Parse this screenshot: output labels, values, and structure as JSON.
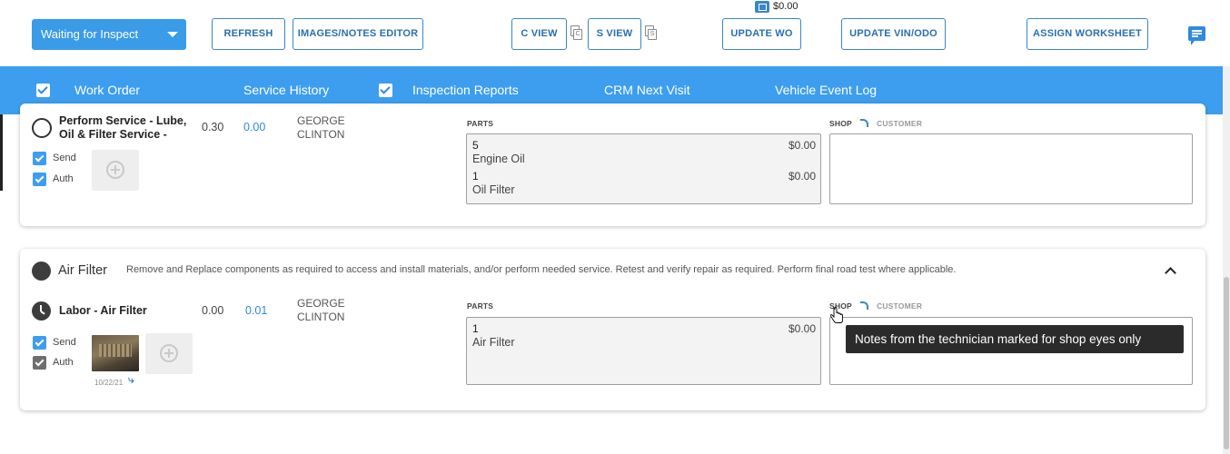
{
  "toolbar": {
    "status_value": "Waiting for Inspect",
    "refresh": "REFRESH",
    "images_notes_editor": "IMAGES/NOTES EDITOR",
    "c_view": "C VIEW",
    "c_copy_letter": "C",
    "s_view": "S VIEW",
    "s_copy_letter": "S",
    "update_wo_price": "$0.00",
    "update_wo": "UPDATE WO",
    "update_vin_odo": "UPDATE VIN/ODO",
    "assign_worksheet": "ASSIGN WORKSHEET"
  },
  "tabs": [
    {
      "label": "Work Order",
      "checked": true
    },
    {
      "label": "Service History",
      "checked": false
    },
    {
      "label": "Inspection Reports",
      "checked": true
    },
    {
      "label": "CRM Next Visit",
      "checked": false
    },
    {
      "label": "Vehicle Event Log",
      "checked": false
    }
  ],
  "card1": {
    "service_name_line1": "Perform Service - Lube,",
    "service_name_line2": "Oil & Filter Service -",
    "hours": "0.30",
    "cost": "0.00",
    "tech_line1": "GEORGE",
    "tech_line2": "CLINTON",
    "send_label": "Send",
    "auth_label": "Auth",
    "parts_label": "PARTS",
    "shop_label": "SHOP",
    "customer_label": "CUSTOMER",
    "parts": [
      {
        "qty": "5",
        "name": "Engine Oil",
        "price": "$0.00"
      },
      {
        "qty": "1",
        "name": "Oil Filter",
        "price": "$0.00"
      }
    ]
  },
  "card2": {
    "title": "Air Filter",
    "description": "Remove and Replace components as required to access and install materials, and/or perform needed service. Retest and verify repair as required. Perform final road test where applicable.",
    "labor_name": "Labor - Air Filter",
    "hours": "0.00",
    "cost": "0.01",
    "tech_line1": "GEORGE",
    "tech_line2": "CLINTON",
    "send_label": "Send",
    "auth_label": "Auth",
    "photo_date": "10/22/21",
    "parts_label": "PARTS",
    "shop_label": "SHOP",
    "customer_label": "CUSTOMER",
    "parts": [
      {
        "qty": "1",
        "name": "Air Filter",
        "price": "$0.00"
      }
    ]
  },
  "tooltip": "Notes from the technician marked for shop eyes only",
  "colors": {
    "accent": "#3d9ef0",
    "button_text": "#2a6fb0",
    "tooltip_bg": "#2b2b2b"
  }
}
